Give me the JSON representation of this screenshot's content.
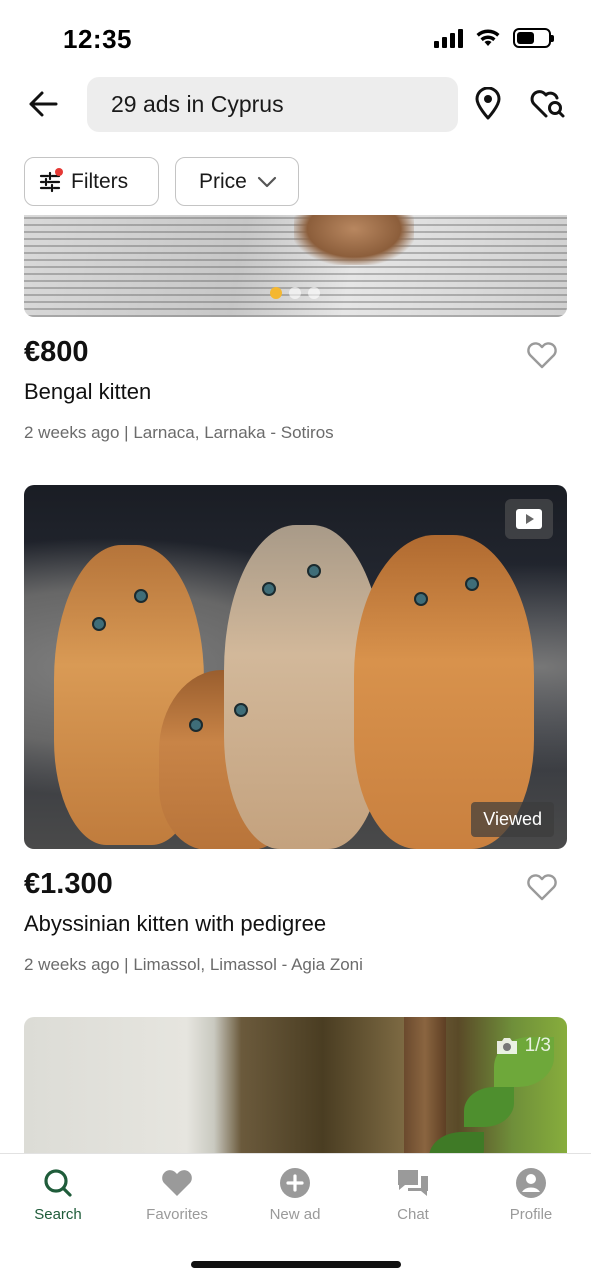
{
  "status_bar": {
    "time": "12:35",
    "battery_percent": 55
  },
  "header": {
    "back_icon": "arrow-left-icon",
    "search_text": "29 ads in Cyprus",
    "location_icon": "map-pin-icon",
    "saved_search_icon": "heart-search-icon"
  },
  "filters": {
    "filters_label": "Filters",
    "price_label": "Price"
  },
  "listings": [
    {
      "price": "€800",
      "title": "Bengal kitten",
      "meta": "2 weeks ago | Larnaca, Larnaka - Sotiros",
      "image_count": 3,
      "active_image": 1
    },
    {
      "price": "€1.300",
      "title": "Abyssinian kitten with pedigree",
      "meta": "2 weeks ago | Limassol, Limassol - Agia Zoni",
      "viewed_label": "Viewed",
      "has_video": true
    },
    {
      "photo_counter": "1/3"
    }
  ],
  "bottom_nav": [
    {
      "label": "Search",
      "icon": "search-icon",
      "active": true
    },
    {
      "label": "Favorites",
      "icon": "heart-icon",
      "active": false
    },
    {
      "label": "New ad",
      "icon": "plus-circle-icon",
      "active": false
    },
    {
      "label": "Chat",
      "icon": "chat-bubbles-icon",
      "active": false
    },
    {
      "label": "Profile",
      "icon": "user-icon",
      "active": false
    }
  ],
  "colors": {
    "accent_green": "#1f5c3a",
    "carousel_active": "#f4b731",
    "filter_dot": "#e53935"
  }
}
